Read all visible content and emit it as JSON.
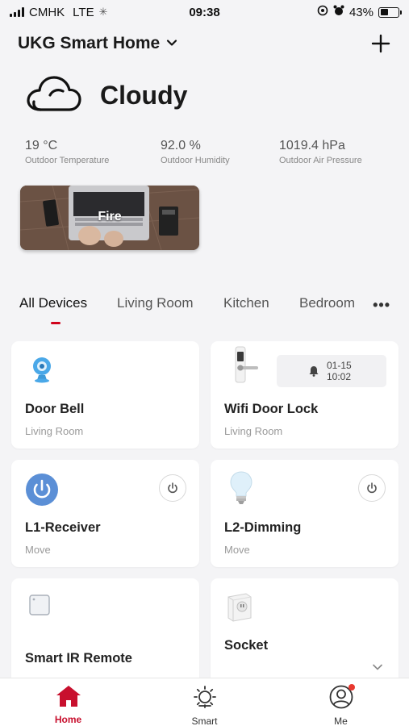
{
  "status_bar": {
    "carrier": "CMHK",
    "network": "LTE",
    "time": "09:38",
    "battery_percent": "43%",
    "battery_level": 0.43
  },
  "header": {
    "home_name": "UKG Smart Home",
    "add_icon": "plus-icon"
  },
  "weather": {
    "condition": "Cloudy",
    "icon": "cloud-icon",
    "metrics": [
      {
        "value": "19 °C",
        "label": "Outdoor Temperature"
      },
      {
        "value": "92.0 %",
        "label": "Outdoor Humidity"
      },
      {
        "value": "1019.4 hPa",
        "label": "Outdoor Air Pressure"
      }
    ]
  },
  "scene": {
    "label": "Fire"
  },
  "tabs": {
    "items": [
      "All Devices",
      "Living Room",
      "Kitchen",
      "Bedroom"
    ],
    "active": "All Devices",
    "more_icon": "more-dots-icon"
  },
  "devices": [
    {
      "name": "Door Bell",
      "room": "Living Room",
      "icon": "camera-icon"
    },
    {
      "name": "Wifi Door Lock",
      "room": "Living Room",
      "icon": "door-lock-icon",
      "alarm": {
        "date": "01-15",
        "time": "10:02",
        "icon": "bell-icon"
      }
    },
    {
      "name": "L1-Receiver",
      "room": "Move",
      "icon": "power-circle-icon",
      "power_icon": "power-icon"
    },
    {
      "name": "L2-Dimming",
      "room": "Move",
      "icon": "light-bulb-icon",
      "power_icon": "power-icon"
    },
    {
      "name": "Smart IR Remote",
      "room": "",
      "icon": "ir-remote-icon"
    },
    {
      "name": "Socket",
      "room": "",
      "icon": "socket-icon",
      "expand_icon": "chevron-down-icon"
    }
  ],
  "bottom_nav": [
    {
      "label": "Home",
      "icon": "home-icon",
      "active": true
    },
    {
      "label": "Smart",
      "icon": "sun-icon",
      "active": false
    },
    {
      "label": "Me",
      "icon": "user-icon",
      "active": false
    }
  ],
  "colors": {
    "accent": "#c8102e",
    "tab_indicator": "#d0021b",
    "power_blue": "#5b8fd6",
    "background": "#f4f4f6"
  }
}
